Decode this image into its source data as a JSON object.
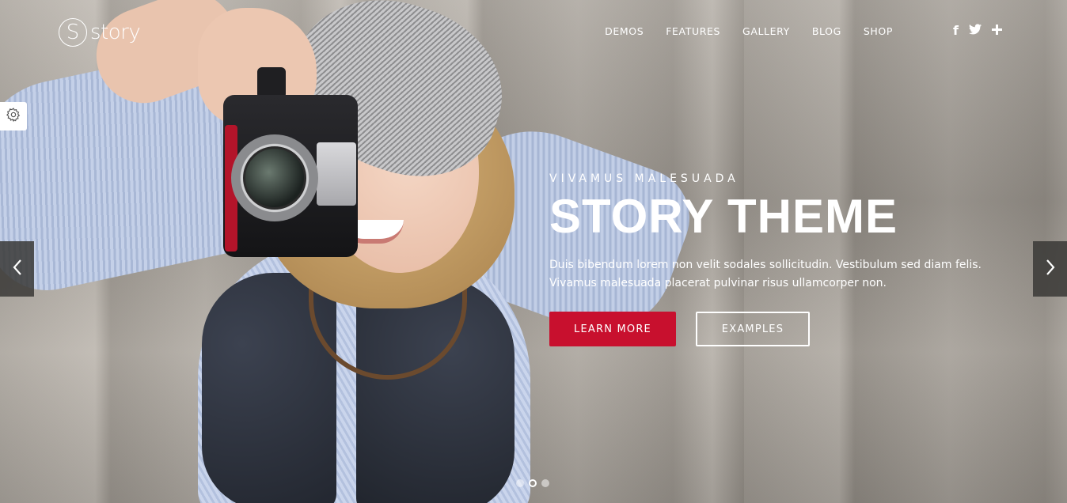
{
  "brand": {
    "logo_letter": "S",
    "logo_text": "story"
  },
  "nav": {
    "items": [
      {
        "label": "DEMOS"
      },
      {
        "label": "FEATURES"
      },
      {
        "label": "GALLERY"
      },
      {
        "label": "BLOG"
      },
      {
        "label": "SHOP"
      }
    ],
    "social": [
      {
        "icon": "facebook-icon",
        "glyph": "f"
      },
      {
        "icon": "twitter-icon",
        "glyph": "🐦"
      },
      {
        "icon": "plus-icon",
        "glyph": "+"
      }
    ]
  },
  "slide": {
    "eyebrow": "VIVAMUS MALESUADA",
    "title": "STORY THEME",
    "description": "Duis bibendum lorem non velit sodales sollicitudin. Vestibulum sed diam felis. Vivamus malesuada placerat pulvinar risus ullamcorper non.",
    "primary_button": "LEARN MORE",
    "secondary_button": "EXAMPLES",
    "active_dot": 2,
    "dot_count": 3
  },
  "colors": {
    "accent": "#c8102e",
    "arrow_bg": "#3a3836"
  }
}
